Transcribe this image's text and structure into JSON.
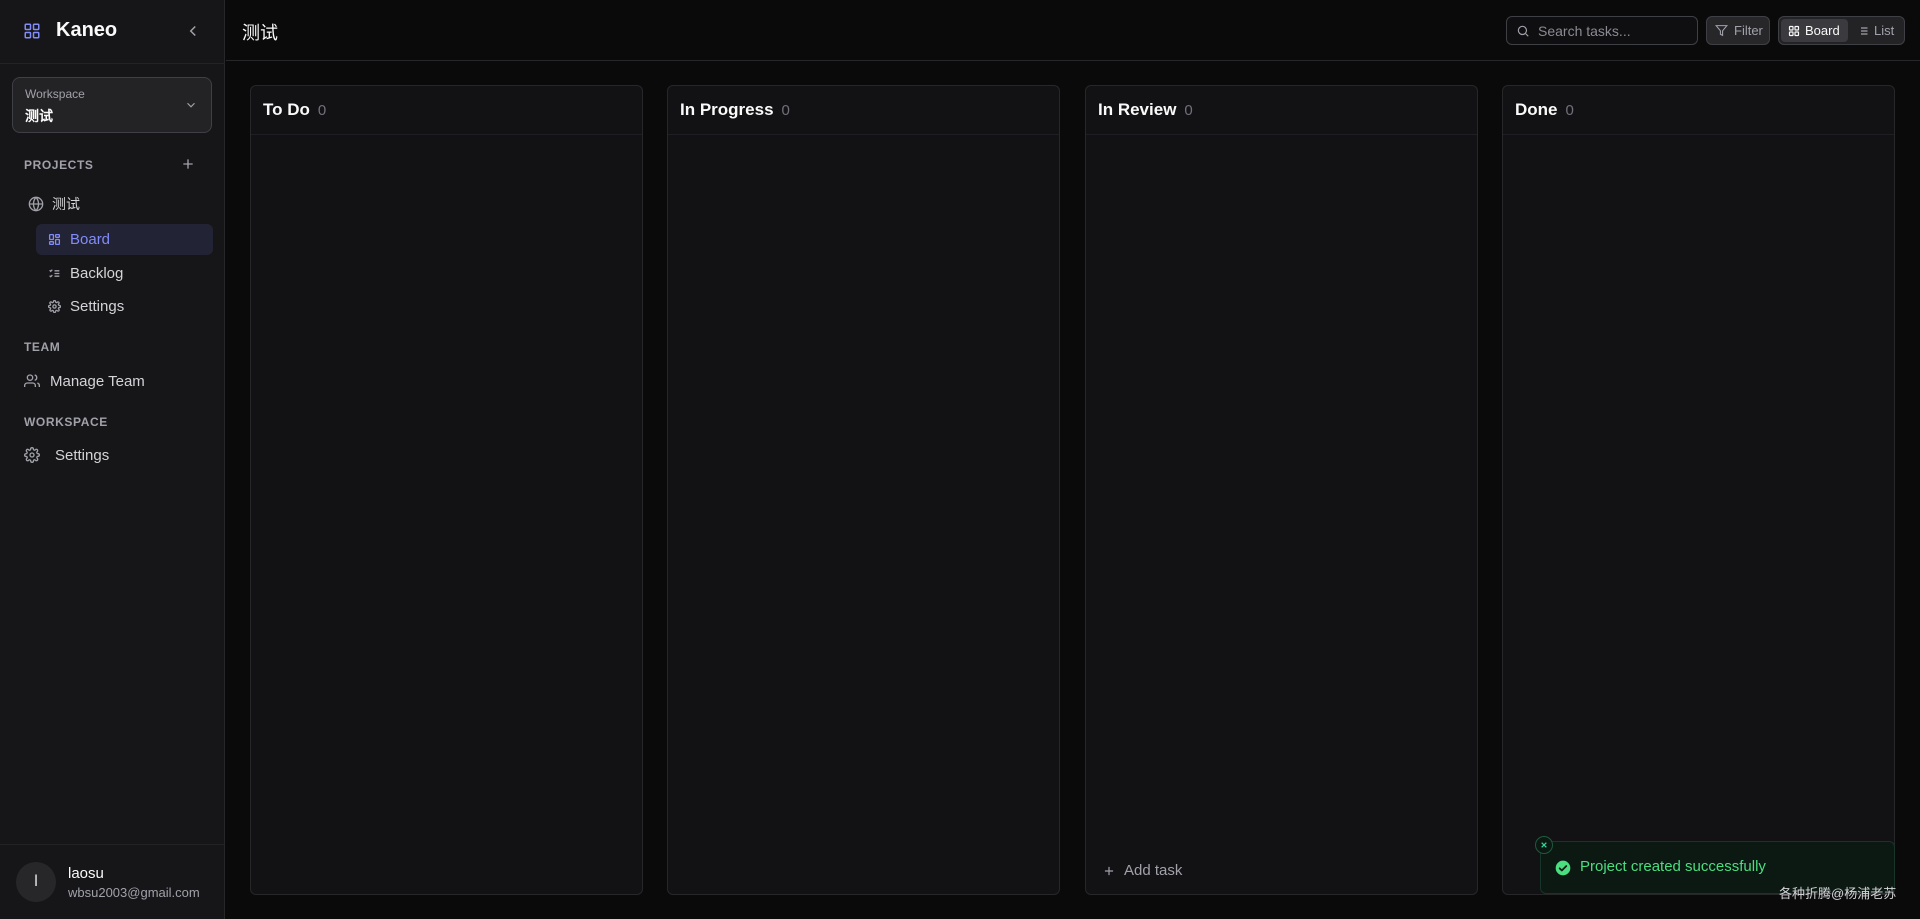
{
  "sidebar": {
    "app_name": "Kaneo",
    "workspace": {
      "label": "Workspace",
      "name": "测试"
    },
    "projects_title": "PROJECTS",
    "project": {
      "name": "测试",
      "items": [
        {
          "label": "Board"
        },
        {
          "label": "Backlog"
        },
        {
          "label": "Settings"
        }
      ]
    },
    "team_title": "TEAM",
    "team_items": [
      {
        "label": "Manage Team"
      }
    ],
    "workspace_title": "WORKSPACE",
    "workspace_items": [
      {
        "label": "Settings"
      }
    ],
    "user": {
      "initial": "l",
      "name": "laosu",
      "email": "wbsu2003@gmail.com"
    }
  },
  "header": {
    "title": "测试",
    "search_placeholder": "Search tasks...",
    "filter_label": "Filter",
    "view_board_label": "Board",
    "view_list_label": "List"
  },
  "board": {
    "columns": [
      {
        "title": "To Do",
        "count": "0"
      },
      {
        "title": "In Progress",
        "count": "0"
      },
      {
        "title": "In Review",
        "count": "0"
      },
      {
        "title": "Done",
        "count": "0"
      }
    ],
    "add_task_label": "Add task"
  },
  "toast": {
    "message": "Project created successfully"
  },
  "watermark": "各种折腾@杨浦老苏",
  "colors": {
    "accent": "#818cf8",
    "success": "#4ade80",
    "background": "#0a0a0b"
  }
}
